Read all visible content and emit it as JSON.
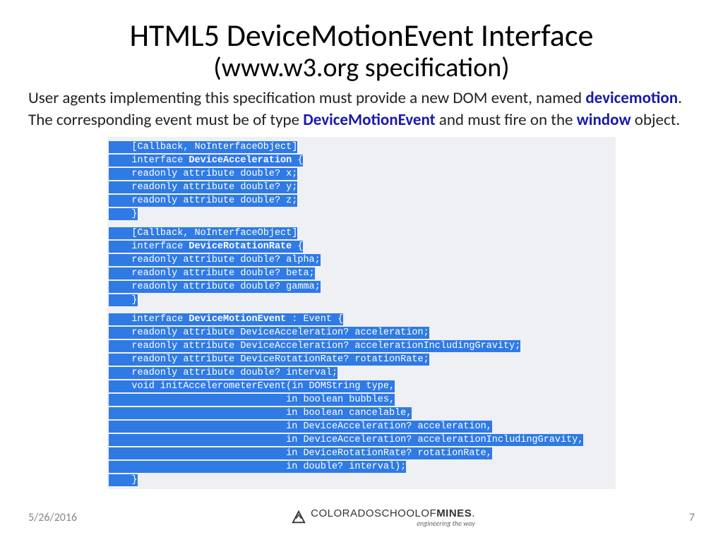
{
  "title": "HTML5 DeviceMotionEvent Interface",
  "subtitle": "(www.w3.org specification)",
  "para": {
    "t1": "User agents implementing this specification must provide a new DOM event, named ",
    "k1": "devicemotion",
    "t2": ". The corresponding event must be of type ",
    "k2": "DeviceMotionEvent",
    "t3": " and must fire on the ",
    "k3": "window",
    "t4": " object."
  },
  "code": [
    {
      "i": 4,
      "t": "[Callback, NoInterfaceObject]"
    },
    {
      "i": 4,
      "pre": "interface ",
      "b": "DeviceAcceleration",
      "post": " {"
    },
    {
      "i": 4,
      "t": "readonly attribute double? x;"
    },
    {
      "i": 4,
      "t": "readonly attribute double? y;"
    },
    {
      "i": 4,
      "t": "readonly attribute double? z;"
    },
    {
      "i": 4,
      "t": "}"
    },
    {
      "gap": true
    },
    {
      "i": 4,
      "t": "[Callback, NoInterfaceObject]"
    },
    {
      "i": 4,
      "pre": "interface ",
      "b": "DeviceRotationRate",
      "post": " {"
    },
    {
      "i": 4,
      "t": "readonly attribute double? alpha;"
    },
    {
      "i": 4,
      "t": "readonly attribute double? beta;"
    },
    {
      "i": 4,
      "t": "readonly attribute double? gamma;"
    },
    {
      "i": 4,
      "t": "}"
    },
    {
      "gap": true
    },
    {
      "i": 4,
      "pre": "interface ",
      "b": "DeviceMotionEvent",
      "post": " : Event {"
    },
    {
      "i": 4,
      "t": "readonly attribute DeviceAcceleration? acceleration;"
    },
    {
      "i": 4,
      "t": "readonly attribute DeviceAcceleration? accelerationIncludingGravity;"
    },
    {
      "i": 4,
      "t": "readonly attribute DeviceRotationRate? rotationRate;"
    },
    {
      "i": 4,
      "t": "readonly attribute double? interval;"
    },
    {
      "i": 4,
      "t": "void initAccelerometerEvent(in DOMString type,"
    },
    {
      "i": 31,
      "t": "in boolean bubbles,"
    },
    {
      "i": 31,
      "t": "in boolean cancelable,"
    },
    {
      "i": 31,
      "t": "in DeviceAcceleration? acceleration,"
    },
    {
      "i": 31,
      "t": "in DeviceAcceleration? accelerationIncludingGravity,"
    },
    {
      "i": 31,
      "t": "in DeviceRotationRate? rotationRate,"
    },
    {
      "i": 31,
      "t": "in double? interval);"
    },
    {
      "i": 4,
      "t": "}"
    }
  ],
  "footer": {
    "date": "5/26/2016",
    "page": "7",
    "logo": {
      "part1": "COLORADO",
      "part2": "SCHOOLOF",
      "part3": "MINES",
      "tagline": "engineering the way"
    }
  }
}
